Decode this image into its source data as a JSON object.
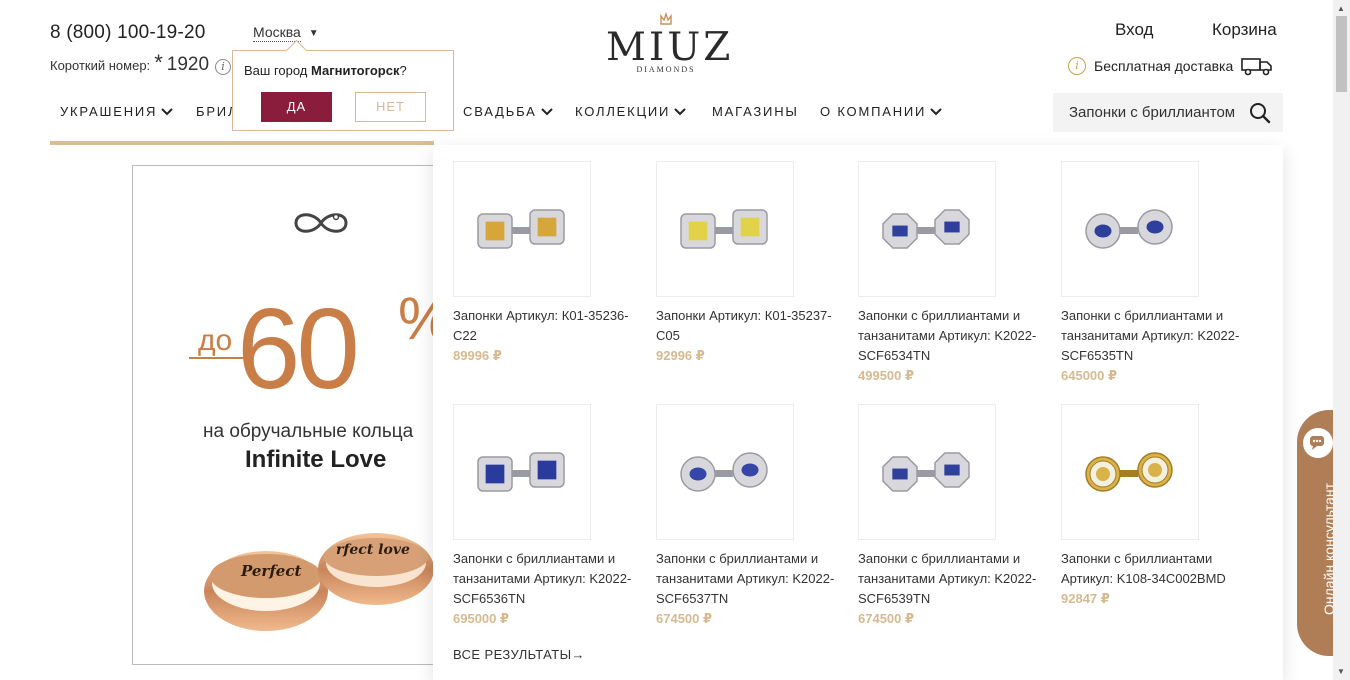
{
  "header": {
    "phone": "8 (800) 100-19-20",
    "short_number_label": "Короткий номер:",
    "short_number_star": "*",
    "short_number_value": "1920",
    "short_number_info": "i",
    "city": "Москва",
    "city_arrow": "▼",
    "login": "Вход",
    "cart": "Корзина",
    "delivery_info": "i",
    "delivery": "Бесплатная доставка"
  },
  "logo": {
    "brand": "MIUZ",
    "sub": "DIAMONDS"
  },
  "city_popup": {
    "question_prefix": "Ваш город ",
    "city": "Магнитогорск",
    "question_suffix": "?",
    "yes": "ДА",
    "no": "НЕТ"
  },
  "nav": [
    {
      "label": "УКРАШЕНИЯ",
      "chev": "❯"
    },
    {
      "label": "БРИЛ",
      "chev": ""
    },
    {
      "label": "СВАДЬБА",
      "chev": "❯"
    },
    {
      "label": "КОЛЛЕКЦИИ",
      "chev": "❯"
    },
    {
      "label": "МАГАЗИНЫ",
      "chev": ""
    },
    {
      "label": "О КОМПАНИИ",
      "chev": "❯"
    }
  ],
  "search": {
    "value": "Запонки с бриллиантом"
  },
  "banner": {
    "pre": "до",
    "value": "60",
    "sign": "%",
    "line1": "на обручальные кольца",
    "line2": "Infinite Love"
  },
  "results": {
    "items": [
      {
        "title": "Запонки Артикул: К01-35236-С22",
        "price": "89996 ₽",
        "stone": "#d7a63a",
        "metal": "silver",
        "shape": "square"
      },
      {
        "title": "Запонки Артикул: К01-35237-С05",
        "price": "92996 ₽",
        "stone": "#e2d24a",
        "metal": "silver",
        "shape": "square"
      },
      {
        "title": "Запонки с бриллиантами и танзанитами Артикул: K2022-SCF6534TN",
        "price": "499500 ₽",
        "stone": "#2e3f9c",
        "metal": "silver",
        "shape": "octagon"
      },
      {
        "title": "Запонки с бриллиантами и танзанитами Артикул: K2022-SCF6535TN",
        "price": "645000 ₽",
        "stone": "#2e3f9c",
        "metal": "silver",
        "shape": "flower"
      },
      {
        "title": "Запонки с бриллиантами и танзанитами Артикул: K2022-SCF6536TN",
        "price": "695000 ₽",
        "stone": "#2a3b9e",
        "metal": "silver",
        "shape": "square"
      },
      {
        "title": "Запонки с бриллиантами и танзанитами Артикул: K2022-SCF6537TN",
        "price": "674500 ₽",
        "stone": "#3546a8",
        "metal": "silver",
        "shape": "round"
      },
      {
        "title": "Запонки с бриллиантами и танзанитами Артикул: K2022-SCF6539TN",
        "price": "674500 ₽",
        "stone": "#2e3f9c",
        "metal": "silver",
        "shape": "octagon"
      },
      {
        "title": "Запонки с бриллиантами Артикул: K108-34C002BMD",
        "price": "92847 ₽",
        "stone": "#f4f0e0",
        "metal": "gold",
        "shape": "ring"
      }
    ],
    "all_label": "ВСЕ РЕЗУЛЬТАТЫ→"
  },
  "consultant": {
    "label": "Онлайн консультант"
  },
  "colors": {
    "accent": "#8a1c3c",
    "gold": "#d9bc95",
    "banner_orange": "#c97e47",
    "consult": "#b07e56"
  }
}
